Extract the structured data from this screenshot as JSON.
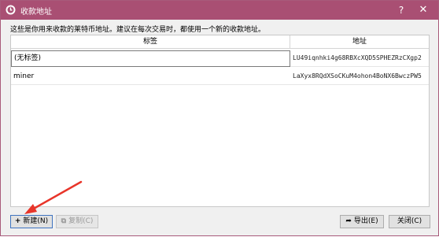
{
  "window": {
    "title": "收款地址",
    "help": "?",
    "close": "✕",
    "accent": "#a94f73"
  },
  "description": "这些是你用来收款的莱特币地址。建议在每次交易时，都使用一个新的收款地址。",
  "table": {
    "columns": {
      "label": "标签",
      "address": "地址"
    },
    "rows": [
      {
        "label": "(无标签)",
        "address": "LU49iqnhki4g68RBXcXQD5SPHEZRzCXgp2",
        "editing": true
      },
      {
        "label": "miner",
        "address": "LaXyx8RQdXSoCKuM4ohon4BoNX6BwczPW5",
        "editing": false
      }
    ]
  },
  "buttons": {
    "new": "新建(N)",
    "copy": "复制(C)",
    "export": "导出(E)",
    "close": "关闭(C)"
  },
  "icons": {
    "title": "app-logo-icon",
    "new": "plus-icon",
    "copy": "copy-icon",
    "export": "export-arrow-icon",
    "annotation": "red-arrow-annotation"
  }
}
